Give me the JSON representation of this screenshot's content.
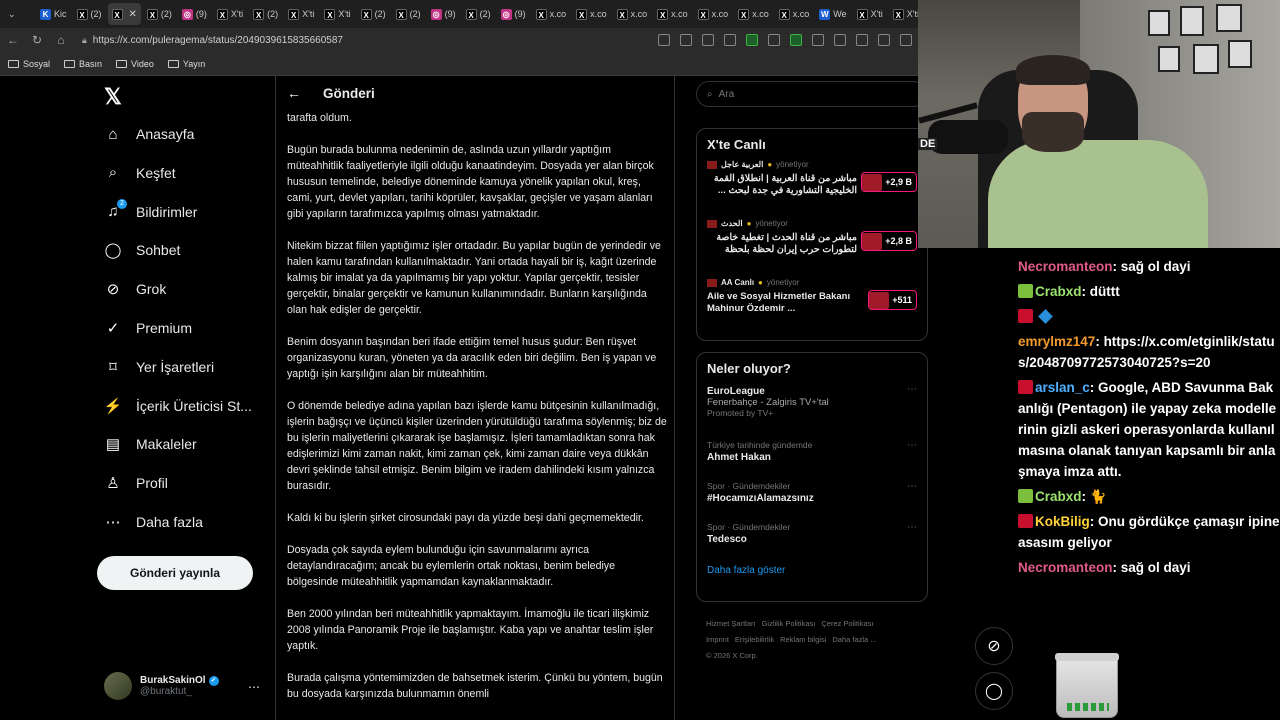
{
  "browser": {
    "tabs": [
      {
        "icon": "K",
        "label": "Kic",
        "style": "tw"
      },
      {
        "icon": "X",
        "label": "(2)",
        "style": "x"
      },
      {
        "icon": "X",
        "label": "",
        "style": "x",
        "active": true
      },
      {
        "icon": "X",
        "label": "(2)",
        "style": "x"
      },
      {
        "icon": "ig",
        "label": "(9)",
        "style": "ig"
      },
      {
        "icon": "X",
        "label": "X'ti",
        "style": "x"
      },
      {
        "icon": "X",
        "label": "(2)",
        "style": "x"
      },
      {
        "icon": "X",
        "label": "X'ti",
        "style": "x"
      },
      {
        "icon": "X",
        "label": "X'ti",
        "style": "x"
      },
      {
        "icon": "X",
        "label": "(2)",
        "style": "x"
      },
      {
        "icon": "X",
        "label": "(2)",
        "style": "x"
      },
      {
        "icon": "ig",
        "label": "(9)",
        "style": "ig"
      },
      {
        "icon": "X",
        "label": "(2)",
        "style": "x"
      },
      {
        "icon": "ig",
        "label": "(9)",
        "style": "ig"
      },
      {
        "icon": "X",
        "label": "x.co",
        "style": "x"
      },
      {
        "icon": "X",
        "label": "x.co",
        "style": "x"
      },
      {
        "icon": "X",
        "label": "x.co",
        "style": "x"
      },
      {
        "icon": "X",
        "label": "x.co",
        "style": "x"
      },
      {
        "icon": "X",
        "label": "x.co",
        "style": "x"
      },
      {
        "icon": "X",
        "label": "x.co",
        "style": "x"
      },
      {
        "icon": "X",
        "label": "x.co",
        "style": "x"
      },
      {
        "icon": "W",
        "label": "We",
        "style": "tw"
      },
      {
        "icon": "X",
        "label": "X'ti",
        "style": "x"
      },
      {
        "icon": "X",
        "label": "X'ti",
        "style": "x"
      },
      {
        "icon": "ig",
        "label": "(9)",
        "style": "ig"
      }
    ],
    "url": "https://x.com/puleragema/status/2049039615835660587",
    "bookmarks": [
      "Sosyal",
      "Basın",
      "Video",
      "Yayın"
    ]
  },
  "nav": {
    "items": [
      {
        "label": "Anasayfa",
        "icon": "home-icon",
        "glyph": "⌂"
      },
      {
        "label": "Keşfet",
        "icon": "search-icon",
        "glyph": "⌕"
      },
      {
        "label": "Bildirimler",
        "icon": "bell-icon",
        "glyph": "♫",
        "badge": "2"
      },
      {
        "label": "Sohbet",
        "icon": "chat-icon",
        "glyph": "◯"
      },
      {
        "label": "Grok",
        "icon": "grok-icon",
        "glyph": "⊘"
      },
      {
        "label": "Premium",
        "icon": "premium-icon",
        "glyph": "✓"
      },
      {
        "label": "Yer İşaretleri",
        "icon": "bookmark-icon",
        "glyph": "⌑"
      },
      {
        "label": "İçerik Üreticisi St...",
        "icon": "rocket-icon",
        "glyph": "⚡"
      },
      {
        "label": "Makaleler",
        "icon": "article-icon",
        "glyph": "▤"
      },
      {
        "label": "Profil",
        "icon": "profile-icon",
        "glyph": "♙"
      },
      {
        "label": "Daha fazla",
        "icon": "more-icon",
        "glyph": "⋯"
      }
    ],
    "post_button": "Gönderi yayınla",
    "profile_name": "BurakSakinOl",
    "profile_handle": "@buraktut_"
  },
  "main": {
    "title": "Gönderi",
    "paragraphs": [
      "tarafta oldum.",
      "Bugün burada bulunma nedenimin de, aslında uzun yıllardır yaptığım müteahhitlik faaliyetleriyle ilgili olduğu kanaatindeyim. Dosyada yer alan birçok hususun temelinde, belediye döneminde kamuya yönelik yapılan okul, kreş, cami, yurt, devlet yapıları, tarihi köprüler, kavşaklar, geçişler ve yaşam alanları gibi yapıların tarafımızca yapılmış olması yatmaktadır.",
      "Nitekim bizzat fiilen yaptığımız işler ortadadır. Bu yapılar bugün de yerindedir ve halen kamu tarafından kullanılmaktadır. Yani ortada hayali bir iş, kağıt üzerinde kalmış bir imalat ya da yapılmamış bir yapı yoktur. Yapılar gerçektir, tesisler gerçektir, binalar gerçektir ve kamunun kullanımındadır. Bunların karşılığında olan hak edişler de gerçektir.",
      "Benim dosyanın başından beri ifade ettiğim temel husus şudur: Ben rüşvet organizasyonu kuran, yöneten ya da aracılık eden biri değilim. Ben iş yapan ve yaptığı işin karşılığını alan bir müteahhitim.",
      "O dönemde belediye adına yapılan bazı işlerde kamu bütçesinin kullanılmadığı, işlerin bağışçı ve üçüncü kişiler üzerinden yürütüldüğü tarafıma söylenmiş; biz de bu işlerin maliyetlerini çıkararak işe başlamışız. İşleri tamamladıktan sonra hak edişlerimizi kimi zaman nakit, kimi zaman çek, kimi zaman daire veya dükkân devri şeklinde tahsil etmişiz. Benim bilgim ve iradem dahilindeki kısım yalnızca burasıdır.",
      "Kaldı ki bu işlerin şirket cirosundaki payı da yüzde beşi dahi geçmemektedir.",
      "Dosyada çok sayıda eylem bulunduğu için savunmalarımı ayrıca detaylandıracağım; ancak bu eylemlerin ortak noktası, benim belediye bölgesinde müteahhitlik yapmamdan kaynaklanmaktadır.",
      "Ben 2000 yılından beri müteahhitlik yapmaktayım. İmamoğlu ile ticari ilişkimiz 2008 yılında Panoramik Proje ile başlamıştır. Kaba yapı ve anahtar teslim işler yaptık.",
      "Burada çalışma yöntemimizden de bahsetmek isterim. Çünkü bu yöntem, bugün bu dosyada karşınızda bulunmamın önemli"
    ]
  },
  "right": {
    "search_placeholder": "Ara",
    "live_title": "X'te Canlı",
    "live": [
      {
        "channel": "العربية عاجل",
        "status": "yönetiyor",
        "title": "مباشر من قناة العربية | انطلاق القمة الخليجية التشاورية في جدة لبحث ...",
        "count": "+2,9 B"
      },
      {
        "channel": "الحدث",
        "status": "yönetiyor",
        "title": "مباشر من قناة الحدث | تغطية خاصة لتطورات حرب إيران لحظة بلحظة",
        "count": "+2,8 B"
      },
      {
        "channel": "AA Canlı",
        "status": "yönetiyor",
        "title": "Aile ve Sosyal Hizmetler Bakanı Mahinur Özdemir ...",
        "count": "+511"
      }
    ],
    "trends_title": "Neler oluyor?",
    "trends": [
      {
        "ctx": "",
        "title": "EuroLeague",
        "sub": "Fenerbahçe - Zalgiris TV+'tal",
        "promo": "Promoted by TV+"
      },
      {
        "ctx": "Türkiye tarihinde gündemde",
        "title": "Ahmet Hakan",
        "sub": "",
        "promo": ""
      },
      {
        "ctx": "Spor · Gündemdekiler",
        "title": "#HocamızıAlamazsınız",
        "sub": "",
        "promo": ""
      },
      {
        "ctx": "Spor · Gündemdekiler",
        "title": "Tedesco",
        "sub": "",
        "promo": ""
      }
    ],
    "show_more": "Daha fazla göster",
    "footer": [
      "Hizmet Şartları",
      "Gizlilik Politikası",
      "Çerez Politikası",
      "Imprint",
      "Erişilebilirlik",
      "Reklam bilgisi",
      "Daha fazla ...",
      "© 2026 X Corp."
    ]
  },
  "stream": {
    "cam_label": "DE",
    "chat": [
      {
        "badge": "",
        "user": "Necromanteon",
        "user_color": "#e05a8a",
        "text": "sağ ol dayi"
      },
      {
        "badge": "green",
        "user": "Crabxd",
        "user_color": "#9be36c",
        "text": "düttt"
      },
      {
        "badge": "red-blue",
        "user": "",
        "user_color": "#ffffff",
        "text": ""
      },
      {
        "badge": "",
        "user": "emrylmz147",
        "user_color": "#f29b2b",
        "text": "https://x.com/etginlik/status/2048709772573040725?s=20"
      },
      {
        "badge": "red",
        "user": "arslan_c",
        "user_color": "#4fb0ff",
        "text": "Google, ABD Savunma Bakanlığı (Pentagon) ile yapay zeka modellerinin gizli askeri operasyonlarda kullanılmasına olanak tanıyan kapsamlı bir anlaşmaya imza attı."
      },
      {
        "badge": "green",
        "user": "Crabxd",
        "user_color": "#9be36c",
        "text": "🐈"
      },
      {
        "badge": "red",
        "user": "KokBilig",
        "user_color": "#ffd23a",
        "text": "Onu gördükçe çamaşır ipine asasım geliyor"
      },
      {
        "badge": "",
        "user": "Necromanteon",
        "user_color": "#e05a8a",
        "text": "sağ ol dayi"
      }
    ]
  }
}
